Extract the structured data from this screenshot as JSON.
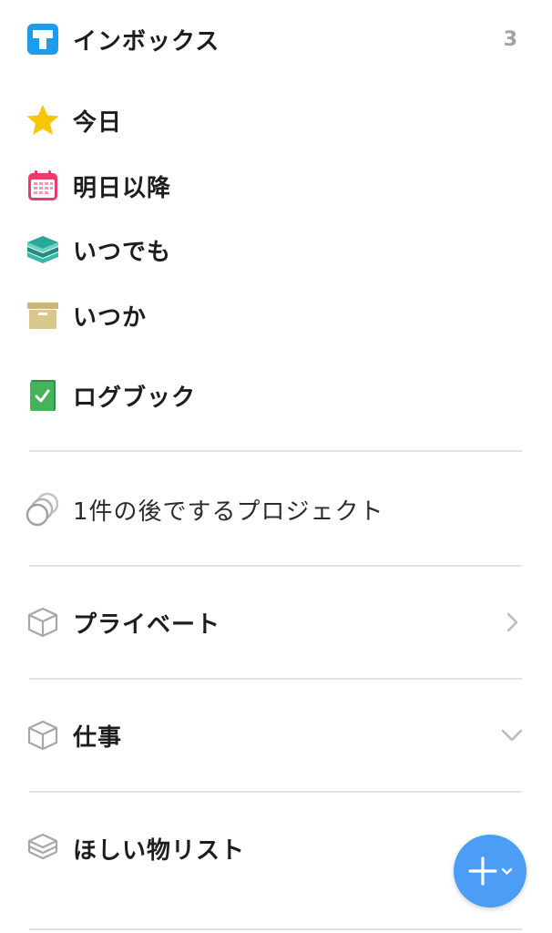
{
  "lists": {
    "inbox": {
      "label": "インボックス",
      "count": "3",
      "icon": "inbox-icon"
    },
    "today": {
      "label": "今日",
      "icon": "star-icon"
    },
    "upcoming": {
      "label": "明日以降",
      "icon": "calendar-icon"
    },
    "anytime": {
      "label": "いつでも",
      "icon": "layers-icon"
    },
    "someday": {
      "label": "いつか",
      "icon": "archive-box-icon"
    },
    "logbook": {
      "label": "ログブック",
      "icon": "logbook-icon"
    }
  },
  "later_projects": {
    "label": "1件の後でするプロジェクト",
    "icon": "later-projects-icon"
  },
  "areas": [
    {
      "label": "プライベート",
      "icon": "area-cube-icon",
      "chevron": "chevron-right-icon"
    },
    {
      "label": "仕事",
      "icon": "area-cube-icon",
      "chevron": "chevron-down-icon"
    },
    {
      "label": "ほしい物リスト",
      "icon": "area-cube-icon"
    }
  ],
  "fab": {
    "icon": "plus-icon"
  },
  "colors": {
    "inbox": "#1e9bea",
    "star": "#f7c600",
    "calendar": "#e93c6b",
    "anytime": "#2aa897",
    "someday": "#c9b67a",
    "logbook": "#46b35a",
    "fab": "#4b9df5",
    "divider": "#e3e3e6"
  }
}
